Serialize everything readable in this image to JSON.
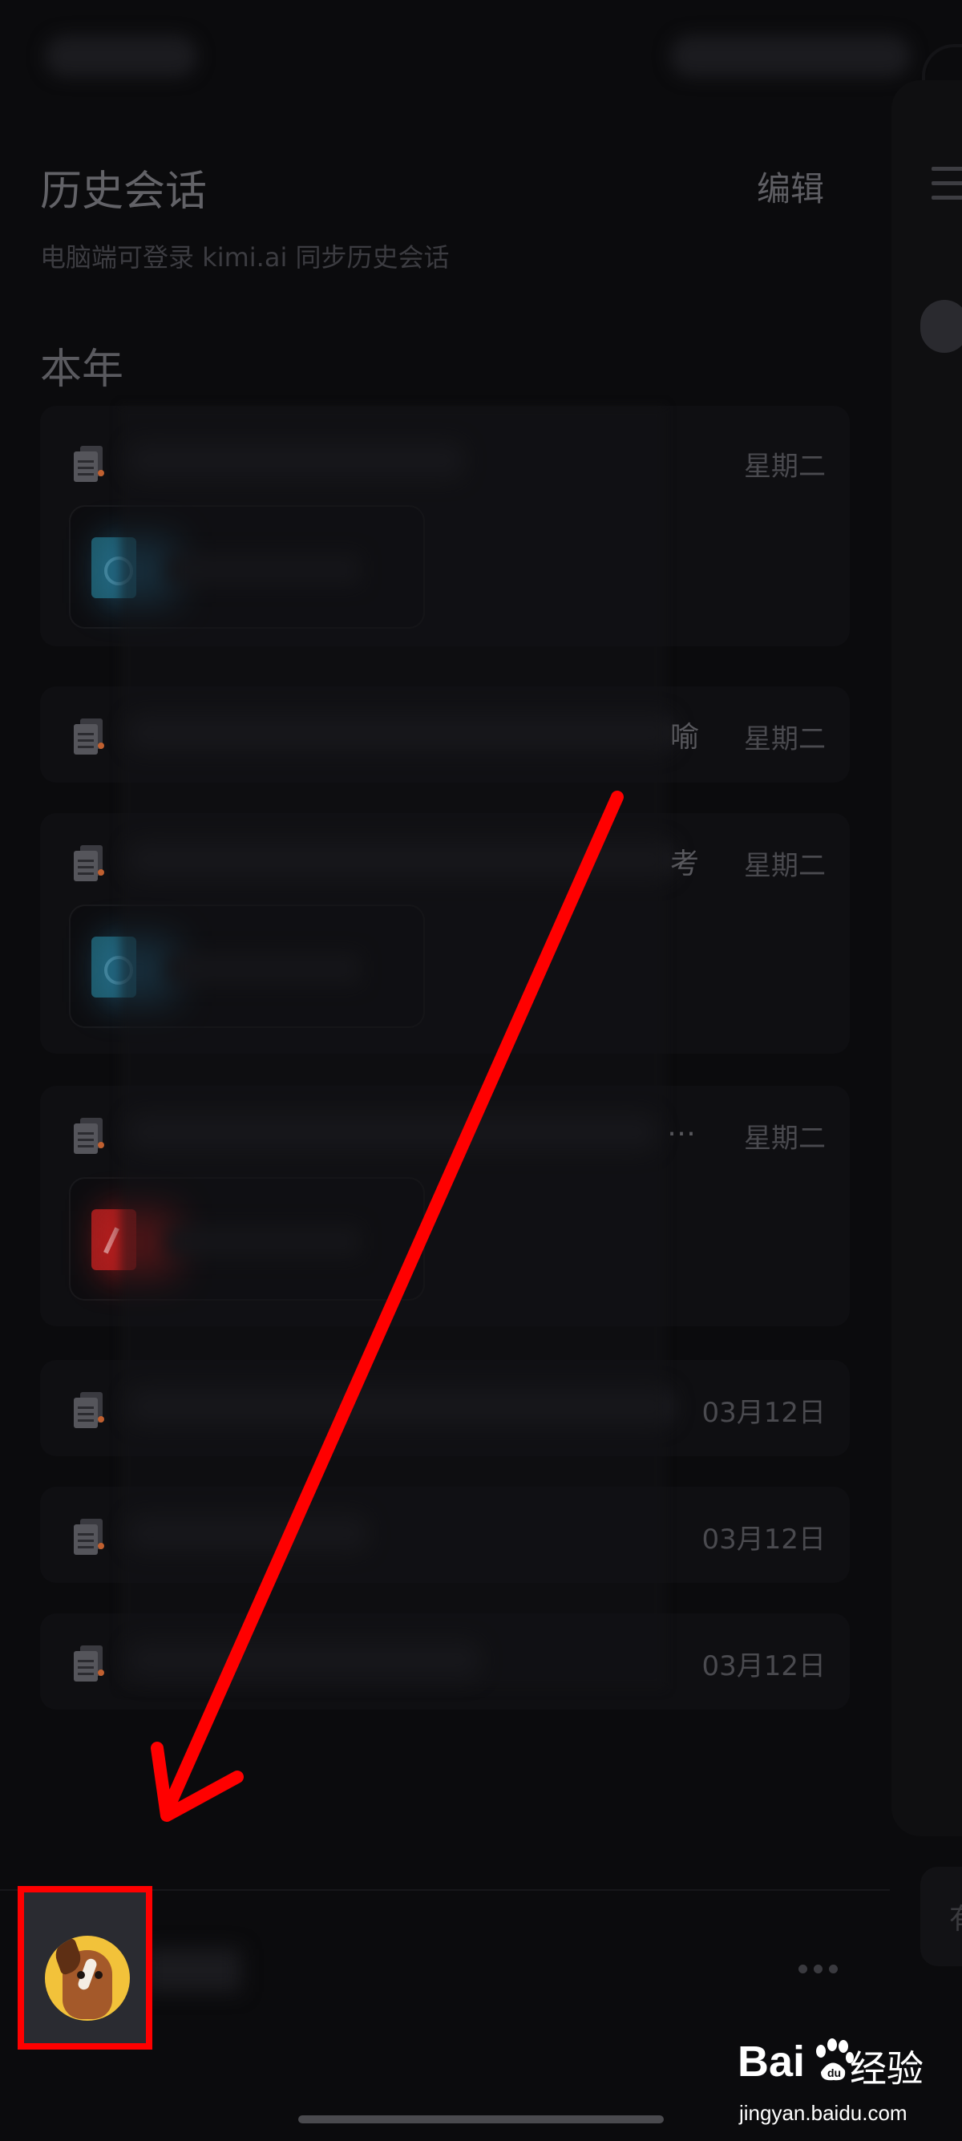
{
  "header": {
    "title": "历史会话",
    "edit_label": "编辑",
    "subtitle": "电脑端可登录 kimi.ai  同步历史会话"
  },
  "section": {
    "label": "本年"
  },
  "conversations": [
    {
      "date": "星期二",
      "tail": "",
      "attachment": "teal"
    },
    {
      "date": "星期二",
      "tail": "喻",
      "attachment": null
    },
    {
      "date": "星期二",
      "tail": "考",
      "attachment": "teal"
    },
    {
      "date": "星期二",
      "tail": "…",
      "attachment": "pdf"
    },
    {
      "date": "03月12日",
      "tail": "",
      "attachment": null
    },
    {
      "date": "03月12日",
      "tail": "",
      "attachment": null
    },
    {
      "date": "03月12日",
      "tail": "",
      "attachment": null
    }
  ],
  "right_panel": {
    "partial_text": "有"
  },
  "annotation": {
    "arrow_color": "#ff0000",
    "highlight_color": "#ff0000"
  },
  "watermark": {
    "brand": "Bai",
    "brand_cn": "经验",
    "url": "jingyan.baidu.com"
  },
  "icons": {
    "doc": "document-stack-icon",
    "menu": "hamburger-icon",
    "more": "more-dots-icon",
    "avatar": "horse-avatar"
  }
}
